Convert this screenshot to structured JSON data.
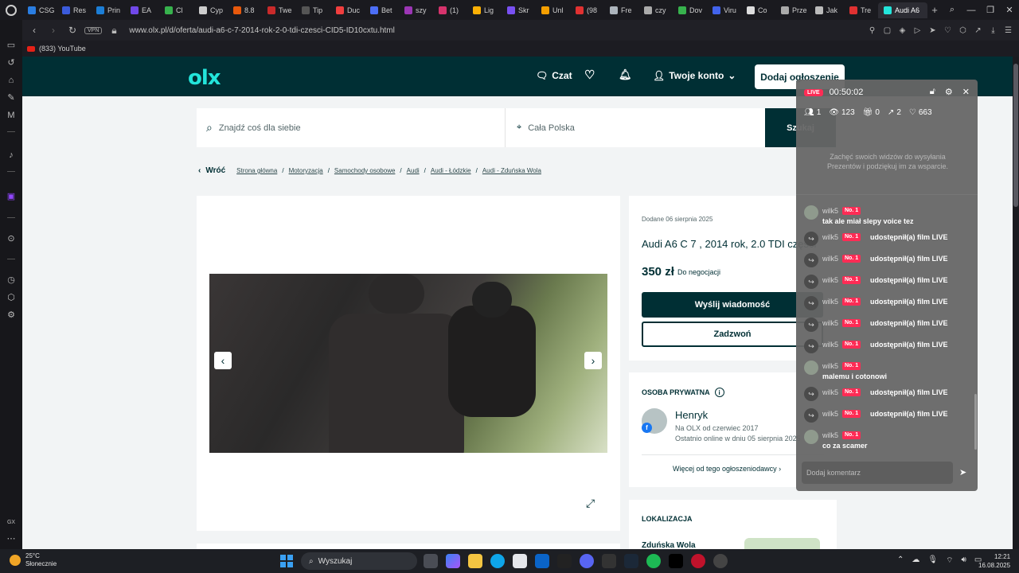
{
  "browser": {
    "tabs": [
      {
        "label": "CSG",
        "color": "#2a7de1"
      },
      {
        "label": "Res",
        "color": "#3b5bdb"
      },
      {
        "label": "Prin",
        "color": "#1c7ed6"
      },
      {
        "label": "EA",
        "color": "#7048e8"
      },
      {
        "label": "Cl",
        "color": "#37b24d"
      },
      {
        "label": "Cyp",
        "color": "#cccccc"
      },
      {
        "label": "8.8",
        "color": "#e8590c"
      },
      {
        "label": "Twe",
        "color": "#c92a2a"
      },
      {
        "label": "Tip",
        "color": "#555555"
      },
      {
        "label": "Duc",
        "color": "#f03e3e"
      },
      {
        "label": "Bet",
        "color": "#4c6ef5"
      },
      {
        "label": "szy",
        "color": "#9c36b5"
      },
      {
        "label": "(1)",
        "color": "#d6336c"
      },
      {
        "label": "Lig",
        "color": "#fab005"
      },
      {
        "label": "Skr",
        "color": "#7950f2"
      },
      {
        "label": "Unl",
        "color": "#f59f00"
      },
      {
        "label": "(98",
        "color": "#e03131"
      },
      {
        "label": "Fre",
        "color": "#adb5bd"
      },
      {
        "label": "czy",
        "color": "#aaaaaa"
      },
      {
        "label": "Dov",
        "color": "#37b24d"
      },
      {
        "label": "Viru",
        "color": "#4263eb"
      },
      {
        "label": "Co",
        "color": "#dddddd"
      },
      {
        "label": "Prze",
        "color": "#aaaaaa"
      },
      {
        "label": "Jak",
        "color": "#bbbbbb"
      },
      {
        "label": "Tre",
        "color": "#e03131"
      }
    ],
    "active_tab": "Audi A6",
    "url": "www.olx.pl/d/oferta/audi-a6-c-7-2014-rok-2-0-tdi-czesci-CID5-ID10cxtu.html",
    "vpn": "VPN",
    "bookmark": "(833) YouTube"
  },
  "olx": {
    "logo": "olx",
    "chat": "Czat",
    "account": "Twoje konto",
    "add_ad": "Dodaj ogłoszenie",
    "search_placeholder": "Znajdź coś dla siebie",
    "location": "Cała Polska",
    "search_button": "Szukaj",
    "back": "Wróć",
    "breadcrumbs": [
      "Strona główna",
      "Motoryzacja",
      "Samochody osobowe",
      "Audi",
      "Audi - Łódzkie",
      "Audi - Zduńska Wola"
    ],
    "added": "Dodane 06 sierpnia 2025",
    "title": "Audi A6 C 7 , 2014 rok, 2.0 TDI części",
    "price": "350 zł",
    "negotiable": "Do negocjacji",
    "message_button": "Wyślij wiadomość",
    "call_button": "Zadzwoń",
    "seller_header": "OSOBA PRYWATNA",
    "seller_name": "Henryk",
    "seller_since": "Na OLX od czerwiec 2017",
    "seller_online": "Ostatnio online w dniu 05 sierpnia 2025",
    "more_ads": "Więcej od tego ogłoszeniodawcy",
    "location_header": "LOKALIZACJA",
    "location_city": "Zduńska Wola"
  },
  "live": {
    "badge": "LIVE",
    "time": "00:50:02",
    "stats": {
      "users": "1",
      "views": "123",
      "gifts": "0",
      "shares": "2",
      "likes": "663"
    },
    "hint": "Zachęć swoich widzów do wysyłania Prezentów i podziękuj im za wsparcie.",
    "comment_placeholder": "Dodaj komentarz",
    "messages": [
      {
        "user": "wilk5",
        "rank": "No. 1",
        "text": "tak ale miał slepy voice tez",
        "type": "comment"
      },
      {
        "user": "wilk5",
        "rank": "No. 1",
        "text": "udostępnił(a) film LIVE",
        "type": "share"
      },
      {
        "user": "wilk5",
        "rank": "No. 1",
        "text": "udostępnił(a) film LIVE",
        "type": "share"
      },
      {
        "user": "wilk5",
        "rank": "No. 1",
        "text": "udostępnił(a) film LIVE",
        "type": "share"
      },
      {
        "user": "wilk5",
        "rank": "No. 1",
        "text": "udostępnił(a) film LIVE",
        "type": "share"
      },
      {
        "user": "wilk5",
        "rank": "No. 1",
        "text": "udostępnił(a) film LIVE",
        "type": "share"
      },
      {
        "user": "wilk5",
        "rank": "No. 1",
        "text": "udostępnił(a) film LIVE",
        "type": "share"
      },
      {
        "user": "wilk5",
        "rank": "No. 1",
        "text": "malemu i cotonowi",
        "type": "comment"
      },
      {
        "user": "wilk5",
        "rank": "No. 1",
        "text": "udostępnił(a) film LIVE",
        "type": "share"
      },
      {
        "user": "wilk5",
        "rank": "No. 1",
        "text": "udostępnił(a) film LIVE",
        "type": "share"
      },
      {
        "user": "wilk5",
        "rank": "No. 1",
        "text": "co za scamer",
        "type": "comment"
      }
    ]
  },
  "taskbar": {
    "temp": "25°C",
    "weather": "Słonecznie",
    "search": "Wyszukaj",
    "time": "12:21",
    "date": "16.08.2025",
    "gx": "GX"
  }
}
